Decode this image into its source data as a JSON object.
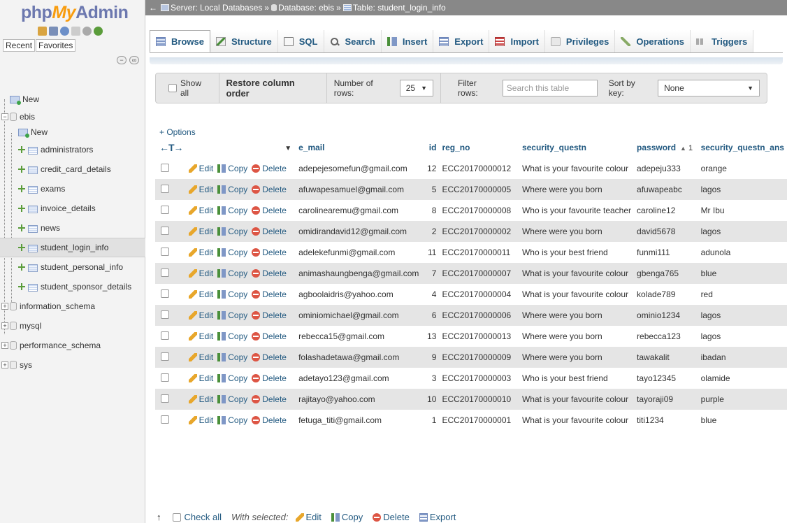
{
  "app": {
    "logo_part1": "php",
    "logo_part2": "My",
    "logo_part3": "Admin"
  },
  "breadcrumb": {
    "back": "←",
    "server": "Server: Local Databases",
    "database": "Database: ebis",
    "table": "Table: student_login_info",
    "separator": "»"
  },
  "sidebar": {
    "recent": "Recent",
    "favorites": "Favorites",
    "items": [
      {
        "label": "New",
        "kind": "new",
        "indent": 0
      },
      {
        "label": "ebis",
        "kind": "db",
        "indent": 0,
        "expanded": true
      },
      {
        "label": "New",
        "kind": "new",
        "indent": 1
      },
      {
        "label": "administrators",
        "kind": "table",
        "indent": 1
      },
      {
        "label": "credit_card_details",
        "kind": "table",
        "indent": 1
      },
      {
        "label": "exams",
        "kind": "table",
        "indent": 1
      },
      {
        "label": "invoice_details",
        "kind": "table",
        "indent": 1
      },
      {
        "label": "news",
        "kind": "table",
        "indent": 1
      },
      {
        "label": "student_login_info",
        "kind": "table",
        "indent": 1,
        "selected": true
      },
      {
        "label": "student_personal_info",
        "kind": "table",
        "indent": 1
      },
      {
        "label": "student_sponsor_details",
        "kind": "table",
        "indent": 1
      },
      {
        "label": "information_schema",
        "kind": "db",
        "indent": 0
      },
      {
        "label": "mysql",
        "kind": "db",
        "indent": 0
      },
      {
        "label": "performance_schema",
        "kind": "db",
        "indent": 0
      },
      {
        "label": "sys",
        "kind": "db",
        "indent": 0
      }
    ]
  },
  "tabs": [
    {
      "label": "Browse",
      "icon": "browse-icon",
      "active": true
    },
    {
      "label": "Structure",
      "icon": "structure-icon"
    },
    {
      "label": "SQL",
      "icon": "sql-icon"
    },
    {
      "label": "Search",
      "icon": "search-icon"
    },
    {
      "label": "Insert",
      "icon": "insert-icon"
    },
    {
      "label": "Export",
      "icon": "export-icon"
    },
    {
      "label": "Import",
      "icon": "import-icon"
    },
    {
      "label": "Privileges",
      "icon": "privileges-icon"
    },
    {
      "label": "Operations",
      "icon": "operations-icon"
    },
    {
      "label": "Triggers",
      "icon": "triggers-icon"
    }
  ],
  "nav": {
    "show_all": "Show all",
    "restore_column_order": "Restore column order",
    "number_of_rows_label": "Number of rows:",
    "number_of_rows_value": "25",
    "filter_rows_label": "Filter rows:",
    "filter_placeholder": "Search this table",
    "sort_by_key_label": "Sort by key:",
    "sort_by_key_value": "None"
  },
  "table": {
    "options_label": "+ Options",
    "action_edit": "Edit",
    "action_copy": "Copy",
    "action_delete": "Delete",
    "columns": [
      "e_mail",
      "id",
      "reg_no",
      "security_questn",
      "password",
      "security_questn_ans"
    ],
    "password_sort_index": "1",
    "rows": [
      [
        "adepejesomefun@gmail.com",
        "12",
        "ECC20170000012",
        "What is your favourite colour",
        "adepeju333",
        "orange"
      ],
      [
        "afuwapesamuel@gmail.com",
        "5",
        "ECC20170000005",
        "Where were you born",
        "afuwapeabc",
        "lagos"
      ],
      [
        "carolinearemu@gmail.com",
        "8",
        "ECC20170000008",
        "Who is your favourite teacher",
        "caroline12",
        "Mr Ibu"
      ],
      [
        "omidirandavid12@gmail.com",
        "2",
        "ECC20170000002",
        "Where were you born",
        "david5678",
        "lagos"
      ],
      [
        "adelekefunmi@gmail.com",
        "11",
        "ECC20170000011",
        "Who is your best friend",
        "funmi111",
        "adunola"
      ],
      [
        "animashaungbenga@gmail.com",
        "7",
        "ECC20170000007",
        "What is your favourite colour",
        "gbenga765",
        "blue"
      ],
      [
        "agboolaidris@yahoo.com",
        "4",
        "ECC20170000004",
        "What is your favourite colour",
        "kolade789",
        "red"
      ],
      [
        "ominiomichael@gmail.com",
        "6",
        "ECC20170000006",
        "Where were you born",
        "ominio1234",
        "lagos"
      ],
      [
        "rebecca15@gmail.com",
        "13",
        "ECC20170000013",
        "Where were you born",
        "rebecca123",
        "lagos"
      ],
      [
        "folashadetawa@gmail.com",
        "9",
        "ECC20170000009",
        "Where were you born",
        "tawakalit",
        "ibadan"
      ],
      [
        "adetayo123@gmail.com",
        "3",
        "ECC20170000003",
        "Who is your best friend",
        "tayo12345",
        "olamide"
      ],
      [
        "rajitayo@yahoo.com",
        "10",
        "ECC20170000010",
        "What is your favourite colour",
        "tayoraji09",
        "purple"
      ],
      [
        "fetuga_titi@gmail.com",
        "1",
        "ECC20170000001",
        "What is your favourite colour",
        "titi1234",
        "blue"
      ]
    ]
  },
  "bottom": {
    "check_all": "Check all",
    "with_selected": "With selected:",
    "edit": "Edit",
    "copy": "Copy",
    "delete": "Delete",
    "export": "Export"
  },
  "colors": {
    "link": "#235a81",
    "breadcrumb_bg": "#888888",
    "row_alt": "#e5e5e5"
  }
}
